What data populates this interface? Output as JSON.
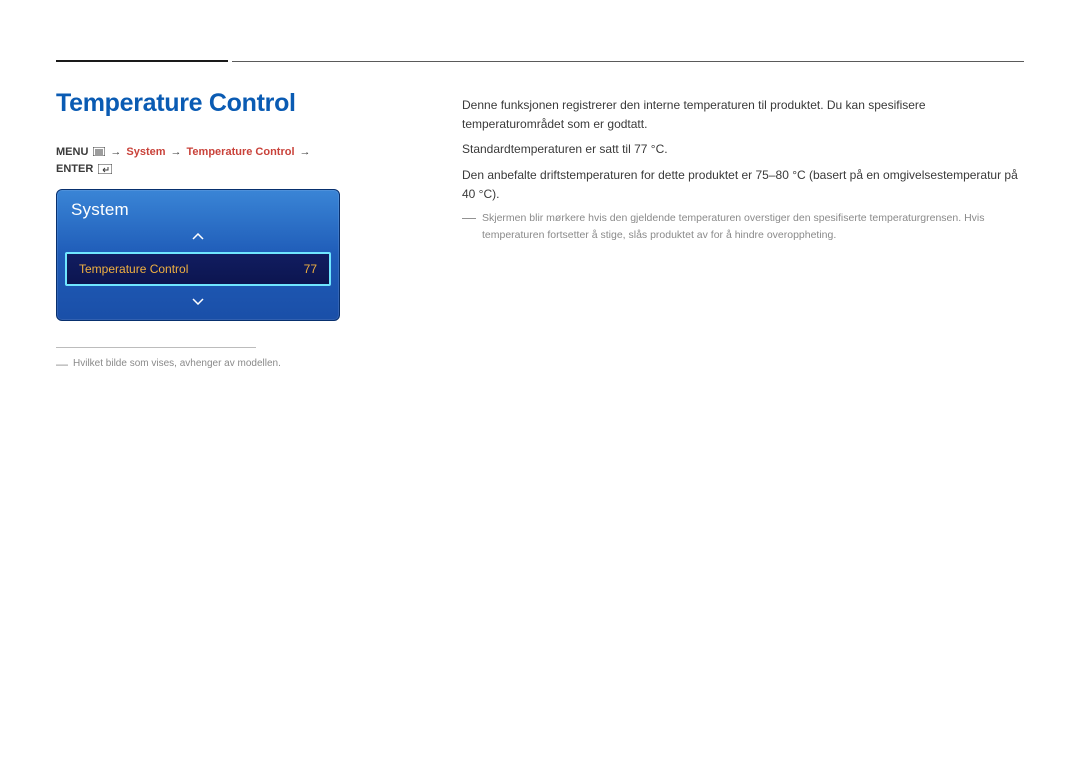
{
  "title": "Temperature Control",
  "breadcrumb": {
    "prefix": "MENU",
    "items": [
      "System",
      "Temperature Control"
    ],
    "suffix": "ENTER",
    "arrow": "→"
  },
  "menuPanel": {
    "header": "System",
    "item": {
      "label": "Temperature Control",
      "value": "77"
    }
  },
  "leftFootnote": "Hvilket bilde som vises, avhenger av modellen.",
  "rightParagraphs": [
    "Denne funksjonen registrerer den interne temperaturen til produktet. Du kan spesifisere temperaturområdet som er godtatt.",
    "Standardtemperaturen er satt til 77 °C.",
    "Den anbefalte driftstemperaturen for dette produktet er 75–80 °C (basert på en omgivelsestemperatur på 40 °C)."
  ],
  "rightNote": "Skjermen blir mørkere hvis den gjeldende temperaturen overstiger den spesifiserte temperaturgrensen. Hvis temperaturen fortsetter å stige, slås produktet av for å hindre overoppheting."
}
